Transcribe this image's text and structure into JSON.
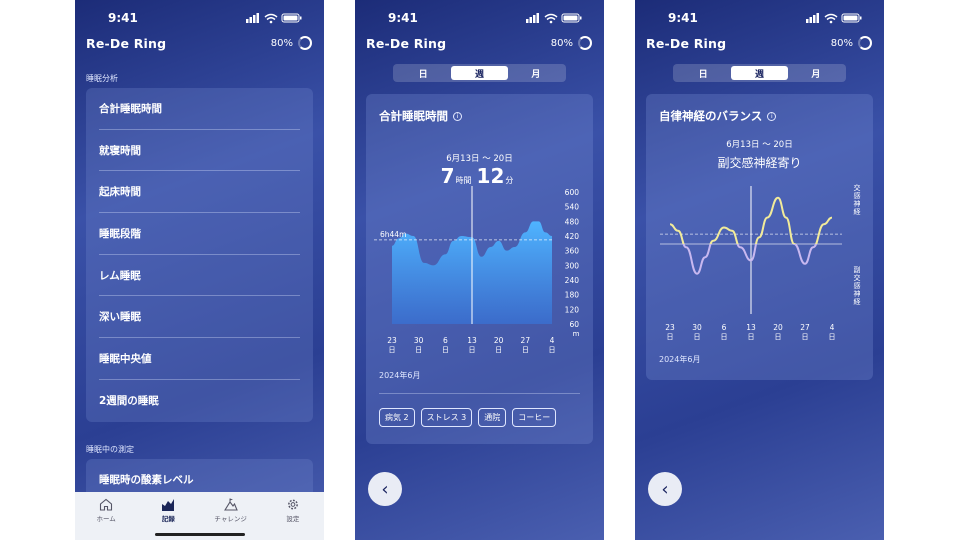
{
  "status": {
    "time": "9:41"
  },
  "app": {
    "title": "Re-De Ring",
    "battery": "80%"
  },
  "screen1": {
    "section1": "睡眠分析",
    "items": [
      "合計睡眠時間",
      "就寝時間",
      "起床時間",
      "睡眠段階",
      "レム睡眠",
      "深い睡眠",
      "睡眠中央値",
      "2週間の睡眠"
    ],
    "section2": "睡眠中の測定",
    "items2": [
      "睡眠時の酸素レベル"
    ],
    "tabs": [
      "ホーム",
      "記録",
      "チャレンジ",
      "設定"
    ],
    "active_tab": "記録"
  },
  "segments": [
    "日",
    "週",
    "月"
  ],
  "active_segment": "週",
  "screen2": {
    "title": "合計睡眠時間",
    "info_icon": "i",
    "date_range": "6月13日 ～ 20日",
    "value_hours": "7",
    "hours_unit": "時間",
    "value_minutes": "12",
    "minutes_unit": "分",
    "avg_label": "6h44m",
    "year_label": "2024年6月",
    "tags": [
      "病気 2",
      "ストレス 3",
      "通院",
      "コーヒー"
    ]
  },
  "screen3": {
    "title": "自律神経のバランス",
    "info_icon": "i",
    "date_range": "6月13日 ～ 20日",
    "status": "副交感神経寄り",
    "label_top": "交感神経",
    "label_bottom": "副交感神経",
    "year_label": "2024年6月"
  },
  "chart_data": [
    {
      "type": "area",
      "title": "合計睡眠時間",
      "x_ticks": [
        "23日",
        "30日",
        "6日",
        "13日",
        "20日",
        "27日",
        "4日"
      ],
      "y_ticks": [
        600,
        540,
        480,
        420,
        360,
        300,
        240,
        180,
        120,
        60
      ],
      "y_unit": "m",
      "ylim": [
        60,
        600
      ],
      "average": 404,
      "average_label": "6h44m",
      "selected_x": "13日",
      "x": [
        0,
        0.25,
        0.5,
        0.8,
        1.2,
        1.55,
        2.0,
        2.3,
        2.6,
        3.0,
        3.35,
        3.7,
        4.0,
        4.3,
        4.6,
        5.0,
        5.3,
        5.5,
        5.75,
        6.0
      ],
      "y": [
        380,
        410,
        430,
        420,
        310,
        300,
        345,
        400,
        420,
        415,
        335,
        375,
        400,
        360,
        375,
        435,
        480,
        480,
        435,
        420
      ],
      "color": "#4fb4ff"
    },
    {
      "type": "line",
      "title": "自律神経のバランス",
      "x_ticks": [
        "23日",
        "30日",
        "6日",
        "13日",
        "20日",
        "27日",
        "4日"
      ],
      "selected_x": "13日",
      "baseline": 0,
      "reference": 0.3,
      "x": [
        0,
        0.3,
        0.6,
        1.0,
        1.3,
        1.6,
        2.0,
        2.3,
        2.6,
        3.0,
        3.3,
        3.6,
        4.0,
        4.3,
        4.6,
        5.0,
        5.3,
        5.7,
        6.0
      ],
      "y": [
        0.6,
        0.4,
        -0.1,
        -0.9,
        -0.4,
        0.1,
        0.5,
        0.4,
        -0.1,
        -0.5,
        0.2,
        0.8,
        1.4,
        0.8,
        0.0,
        -0.6,
        -0.1,
        0.6,
        0.8
      ],
      "color_positive": "#f2eb9a",
      "color_negative": "#c8b8f0"
    }
  ]
}
